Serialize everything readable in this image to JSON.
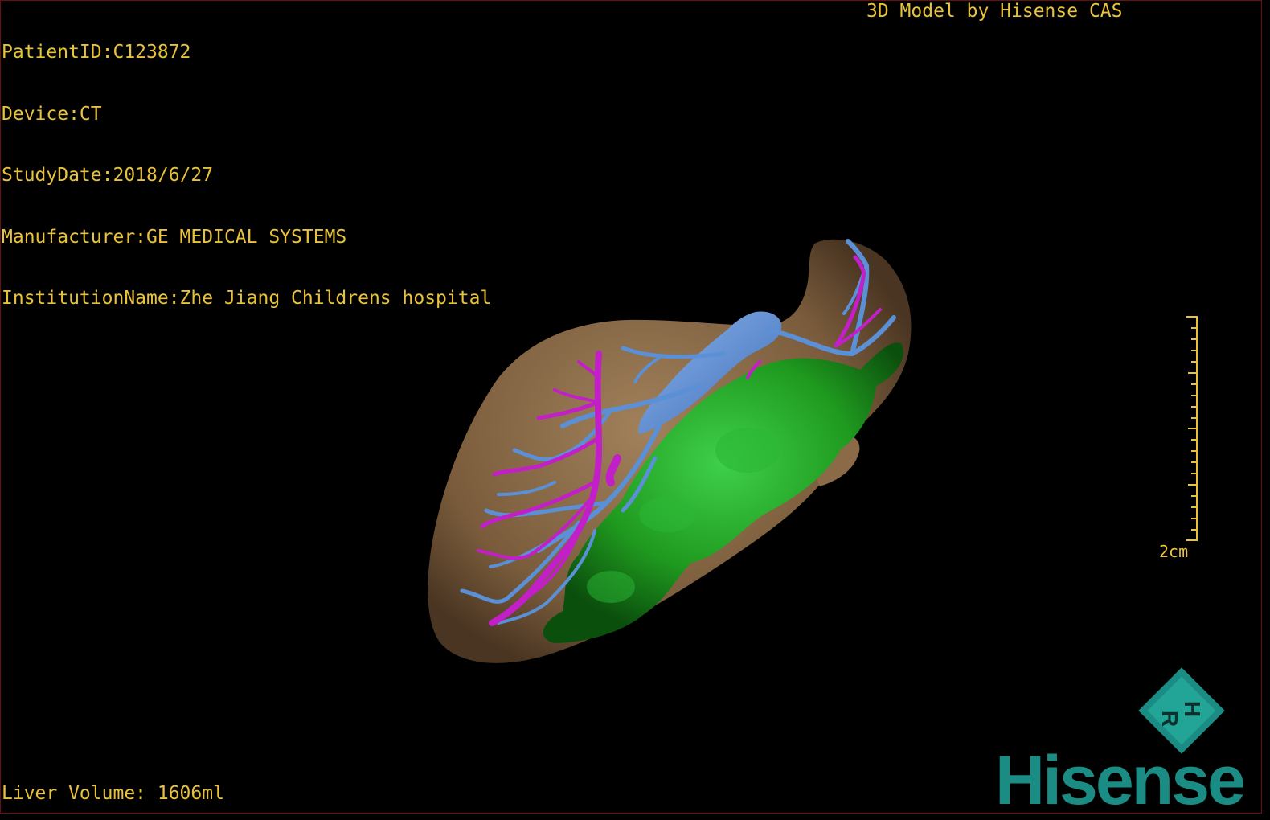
{
  "header": {
    "patient_id": "PatientID:C123872",
    "device": "Device:CT",
    "study_date": "StudyDate:2018/6/27",
    "manufacturer": "Manufacturer:GE MEDICAL SYSTEMS",
    "institution": "InstitutionName:Zhe Jiang Childrens hospital"
  },
  "title": "3D Model by Hisense CAS",
  "footer": {
    "liver_volume": "Liver Volume: 1606ml"
  },
  "scale_bar": {
    "label": "2cm"
  },
  "orientation_cube": {
    "letters": [
      "H",
      "R"
    ]
  },
  "brand": {
    "name": "Hisense"
  },
  "colors": {
    "overlay_text": "#e8c23a",
    "liver": "#7a5c3c",
    "tumor": "#1f9a1f",
    "vein_blue": "#5b8fd6",
    "artery_magenta": "#c21fc9",
    "brand": "#1b8c84"
  },
  "icons": [
    "orientation-cube-icon",
    "scale-bar-icon"
  ]
}
